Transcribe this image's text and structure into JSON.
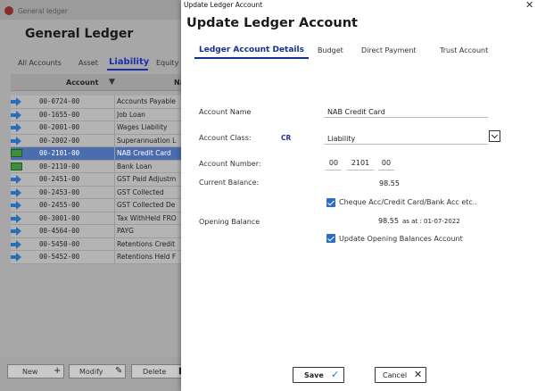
{
  "background_window": {
    "title": "General ledger",
    "heading": "General Ledger",
    "tabs": [
      "All Accounts",
      "Asset",
      "Liability",
      "Equity"
    ],
    "active_tab": "Liability",
    "columns": {
      "account": "Account",
      "name": "Na"
    },
    "rows": [
      {
        "code": "00-0724-00",
        "name": "Accounts Payable",
        "icon": "arrow-right-icon"
      },
      {
        "code": "00-1655-00",
        "name": "Job Loan",
        "icon": "arrow-right-icon"
      },
      {
        "code": "00-2001-00",
        "name": "Wages Liability",
        "icon": "arrow-right-icon"
      },
      {
        "code": "00-2002-00",
        "name": "Superannuation L",
        "icon": "arrow-right-icon"
      },
      {
        "code": "00-2101-00",
        "name": "NAB Credit Card",
        "icon": "cash-icon",
        "selected": true
      },
      {
        "code": "00-2110-00",
        "name": "Bank Loan",
        "icon": "cash-icon"
      },
      {
        "code": "00-2451-00",
        "name": "GST Paid Adjustm",
        "icon": "arrow-right-icon"
      },
      {
        "code": "00-2453-00",
        "name": "GST Collected",
        "icon": "arrow-right-icon"
      },
      {
        "code": "00-2455-00",
        "name": "GST Collected De",
        "icon": "arrow-right-icon"
      },
      {
        "code": "00-3001-00",
        "name": "Tax WithHeld FRO",
        "icon": "arrow-right-icon"
      },
      {
        "code": "00-4564-00",
        "name": "PAYG",
        "icon": "arrow-right-icon"
      },
      {
        "code": "00-5450-00",
        "name": "Retentions Credit",
        "icon": "arrow-right-icon"
      },
      {
        "code": "00-5452-00",
        "name": "Retentions Held F",
        "icon": "arrow-right-icon"
      }
    ],
    "buttons": {
      "new": "New",
      "modify": "Modify",
      "delete": "Delete"
    }
  },
  "dialog": {
    "window_title": "Update Ledger Account",
    "heading": "Update Ledger Account",
    "tabs": [
      "Ledger Account Details",
      "Budget",
      "Direct Payment",
      "Trust Account"
    ],
    "active_tab": "Ledger Account Details",
    "account_name_label": "Account Name",
    "account_name_value": "NAB Credit Card",
    "account_class_label": "Account Class:",
    "account_class_badge": "CR",
    "account_class_value": "Liability",
    "account_number_label": "Account Number:",
    "account_number_parts": [
      "00",
      "2101",
      "00"
    ],
    "current_balance_label": "Current Balance:",
    "current_balance_value": "98.55",
    "cheque_checkbox_label": "Cheque Acc/Credit Card/Bank Acc etc..",
    "cheque_checked": true,
    "opening_balance_label": "Opening Balance",
    "opening_balance_value": "98.55",
    "opening_balance_date": "as at : 01-07-2022",
    "update_opening_label": "Update Opening Balances Account",
    "update_opening_checked": true,
    "save_label": "Save",
    "cancel_label": "Cancel"
  },
  "colors": {
    "accent": "#15308f",
    "selected_row": "#4b6cae",
    "checkbox": "#2a6fc4"
  }
}
